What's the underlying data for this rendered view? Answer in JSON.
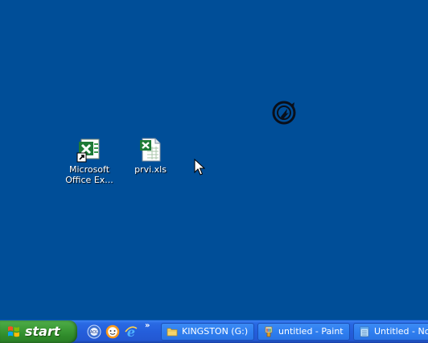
{
  "desktop": {
    "background_color": "#004e98",
    "icons": [
      {
        "label": "Microsoft\nOffice Ex...",
        "icon": "excel-shortcut-icon"
      },
      {
        "label": "prvi.xls",
        "icon": "excel-file-icon"
      }
    ],
    "floating_icon": "sync-icon",
    "cursor": "mouse-pointer"
  },
  "taskbar": {
    "start_label": "start",
    "quick_launch": [
      {
        "icon": "aol-icon"
      },
      {
        "icon": "messenger-icon"
      },
      {
        "icon": "internet-explorer-icon"
      }
    ],
    "overflow": "»",
    "tasks": [
      {
        "label": "KINGSTON (G:)",
        "icon": "folder-icon"
      },
      {
        "label": "untitled - Paint",
        "icon": "paint-icon"
      },
      {
        "label": "Untitled - Notepad",
        "icon": "notepad-icon"
      }
    ]
  }
}
